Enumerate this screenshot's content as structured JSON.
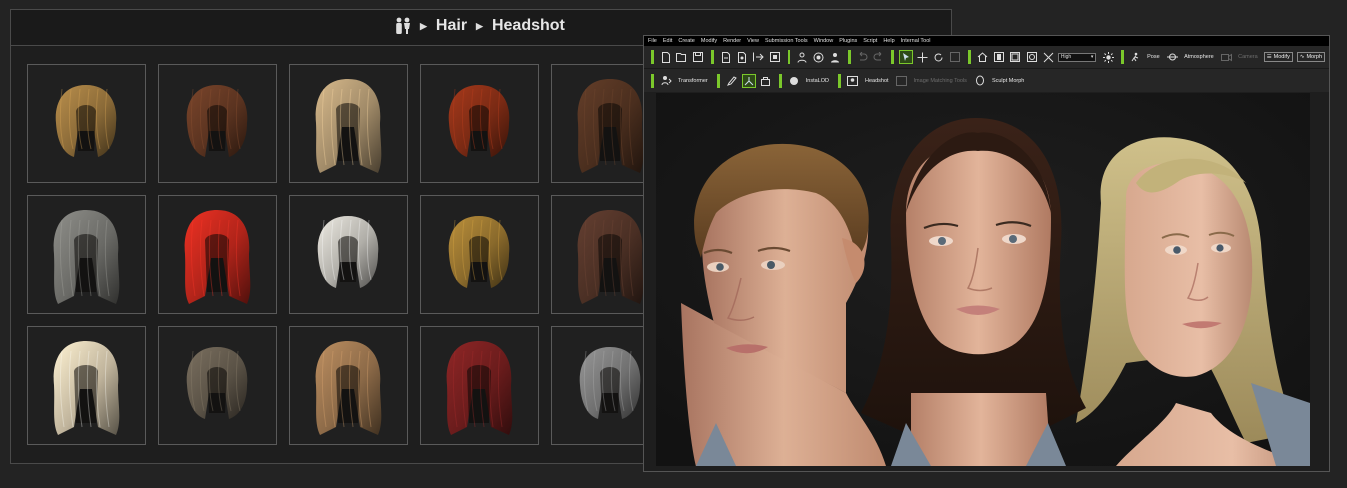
{
  "library": {
    "breadcrumb": [
      "Hair",
      "Headshot"
    ],
    "tiles": [
      {
        "hair": "blonde-wavy-bob",
        "color": "#8a6a38"
      },
      {
        "hair": "auburn-short-curls",
        "color": "#5a3320"
      },
      {
        "hair": "blonde-long-straight",
        "color": "#a08a68"
      },
      {
        "hair": "red-wavy-bob",
        "color": "#7a2a14"
      },
      {
        "hair": "brown-long",
        "color": "#4a2e1e"
      },
      {
        "hair": "grey-long-hood",
        "color": "#6a6a66"
      },
      {
        "hair": "red-long-straight",
        "color": "#b0241a"
      },
      {
        "hair": "silver-short",
        "color": "#b0aea8"
      },
      {
        "hair": "golden-curly",
        "color": "#8a6a2c"
      },
      {
        "hair": "dark-brown-long",
        "color": "#4a2f24"
      },
      {
        "hair": "platinum-long",
        "color": "#c0b49c"
      },
      {
        "hair": "ash-brown-short",
        "color": "#5a5246"
      },
      {
        "hair": "sandy-long",
        "color": "#8c6a48"
      },
      {
        "hair": "crimson-long",
        "color": "#6a1c1c"
      },
      {
        "hair": "grey-shaggy",
        "color": "#707070"
      }
    ]
  },
  "app": {
    "menu": [
      "File",
      "Edit",
      "Create",
      "Modify",
      "Render",
      "View",
      "Submission Tools",
      "Window",
      "Plugins",
      "Script",
      "Help",
      "Internal Tool"
    ],
    "toolbar1": {
      "quality": "High",
      "pose": "Pose",
      "atmosphere": "Atmosphere",
      "camera": "Camera",
      "modify": "Modify",
      "morph": "Morph"
    },
    "toolbar2": {
      "transformer": "Transformer",
      "instalod": "InstaLOD",
      "headshot": "Headshot",
      "image_matching": "Image Matching Tools",
      "sculpt_morph": "Sculpt Morph"
    }
  },
  "colors": {
    "accent": "#7bc82b",
    "panel": "#1d1d1d",
    "border": "#4a4a4a",
    "skin": "#d9a98a"
  }
}
